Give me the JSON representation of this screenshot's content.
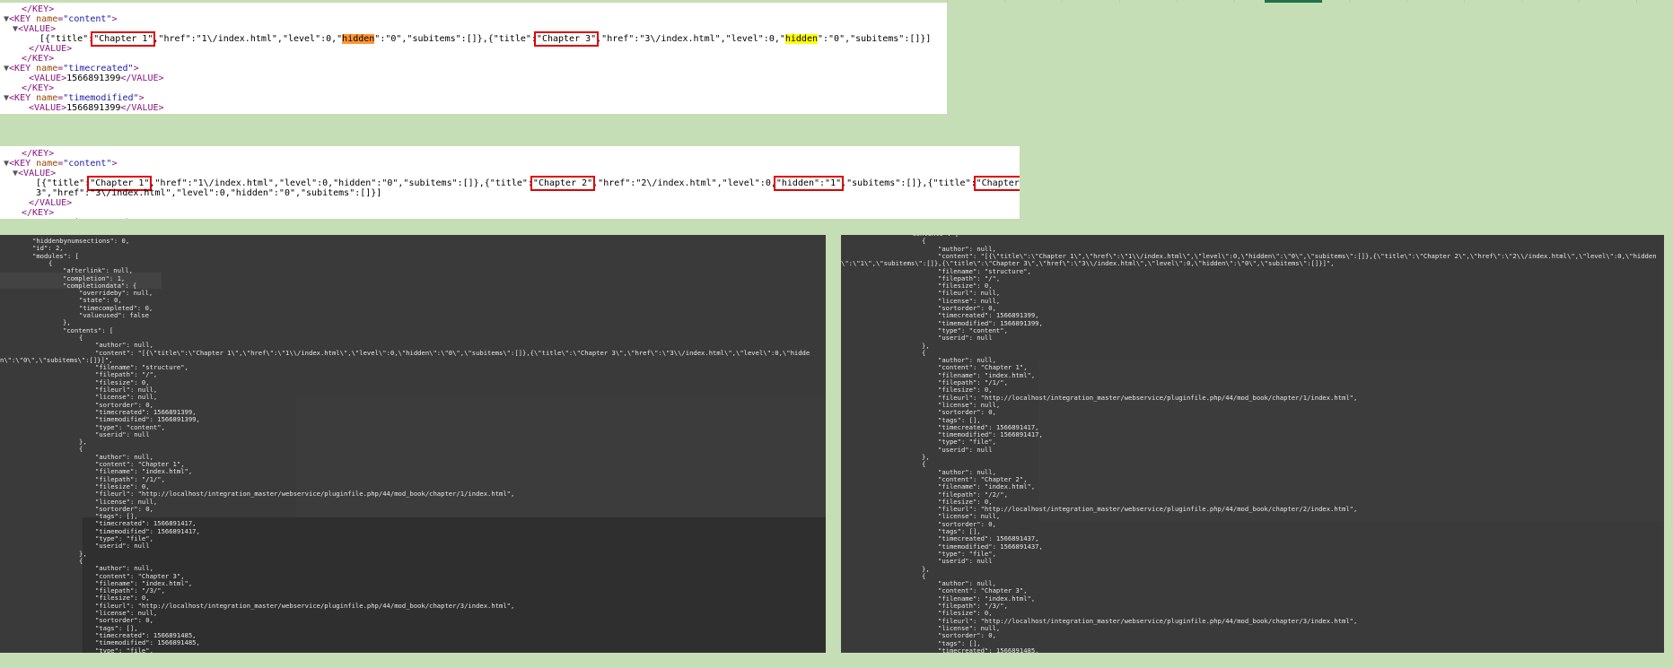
{
  "xml_view_1": {
    "lines": [
      {
        "indent": 24,
        "kind": "close",
        "text": "</KEY>"
      },
      {
        "indent": 14,
        "kind": "open",
        "tri": "▼",
        "tag": "KEY",
        "attr": "name",
        "val": "\"content\""
      },
      {
        "indent": 24,
        "kind": "open",
        "tri": "▼",
        "tag": "VALUE"
      },
      {
        "indent": 44,
        "kind": "data1"
      },
      {
        "indent": 32,
        "kind": "close",
        "text": "</VALUE>"
      },
      {
        "indent": 24,
        "kind": "close",
        "text": "</KEY>"
      },
      {
        "indent": 14,
        "kind": "open",
        "tri": "▼",
        "tag": "KEY",
        "attr": "name",
        "val": "\"timecreated\""
      },
      {
        "indent": 32,
        "kind": "valtext",
        "text": "1566891399"
      },
      {
        "indent": 24,
        "kind": "close",
        "text": "</KEY>"
      },
      {
        "indent": 14,
        "kind": "open",
        "tri": "▼",
        "tag": "KEY",
        "attr": "name",
        "val": "\"timemodified\""
      },
      {
        "indent": 32,
        "kind": "valtext",
        "text": "1566891399"
      }
    ],
    "data_line": {
      "p1": "[{\"title\":",
      "c1": "\"Chapter 1\"",
      "p2": ",\"href\":\"1\\/index.html\",\"level\":0,\"",
      "h1": "hidden",
      "p3": "\":\"0\",\"subitems\":[]},{\"title\":",
      "c2": "\"Chapter 3\"",
      "p4": ",\"href\":\"3\\/index.html\",\"level\":0,\"",
      "h2": "hidden",
      "p5": "\":\"0\",\"subitems\":[]}]"
    }
  },
  "xml_view_2": {
    "lines": [
      {
        "indent": 24,
        "kind": "close",
        "text": "</KEY>"
      },
      {
        "indent": 14,
        "kind": "open",
        "tri": "▼",
        "tag": "KEY",
        "attr": "name",
        "val": "\"content\""
      },
      {
        "indent": 24,
        "kind": "open",
        "tri": "▼",
        "tag": "VALUE"
      },
      {
        "indent": 40,
        "kind": "data2a"
      },
      {
        "indent": 40,
        "kind": "data2b"
      },
      {
        "indent": 32,
        "kind": "close",
        "text": "</VALUE>"
      },
      {
        "indent": 24,
        "kind": "close",
        "text": "</KEY>"
      },
      {
        "indent": 14,
        "kind": "open",
        "tri": "▼",
        "tag": "KEY",
        "attr": "name",
        "val": "\"timecreated\""
      }
    ],
    "data_line_a": {
      "p1": "[{\"title\":",
      "c1": "\"Chapter 1\"",
      "p2": ",\"href\":\"1\\/index.html\",\"level\":0,\"hidden\":\"0\",\"subitems\":[]},{\"title\":",
      "c2": "\"Chapter 2\"",
      "p3": ",\"href\":\"2\\/index.html\",\"level\":0,",
      "h1": "\"hidden\":\"1\"",
      "p4": ",\"subitems\":[]},{\"title\":",
      "c3": "\"Chapter"
    },
    "data_line_b": "3\",\"href\":\"3\\/index.html\",\"level\":0,\"hidden\":\"0\",\"subitems\":[]}]"
  },
  "json_view_left": [
    {
      "i": 36,
      "t": "\"hiddenbynumsections\": 0,"
    },
    {
      "i": 36,
      "t": "\"id\": 2,"
    },
    {
      "i": 36,
      "t": "\"modules\": ["
    },
    {
      "i": 54,
      "t": "{"
    },
    {
      "i": 70,
      "t": "\"afterlink\": null,"
    },
    {
      "i": 70,
      "t": "\"completion\": 1,"
    },
    {
      "i": 70,
      "t": "\"completiondata\": {"
    },
    {
      "i": 88,
      "t": "\"overrideby\": null,"
    },
    {
      "i": 88,
      "t": "\"state\": 0,"
    },
    {
      "i": 88,
      "t": "\"timecompleted\": 0,"
    },
    {
      "i": 88,
      "t": "\"valueused\": false"
    },
    {
      "i": 70,
      "t": "},"
    },
    {
      "i": 70,
      "t": "\"contents\": ["
    },
    {
      "i": 88,
      "t": "{"
    },
    {
      "i": 106,
      "t": "\"author\": null,"
    },
    {
      "i": 106,
      "t": "\"content\": \"[{\\\"title\\\":\\\"Chapter 1\\\",\\\"href\\\":\\\"1\\\\/index.html\\\",\\\"level\\\":0,\\\"hidden\\\":\\\"0\\\",\\\"subitems\\\":[]},{\\\"title\\\":\\\"Chapter 3\\\",\\\"href\\\":\\\"3\\\\/index.html\\\",\\\"level\\\":0,\\\"hidde"
    },
    {
      "i": 0,
      "t": "n\\\":\\\"0\\\",\\\"subitems\\\":[]}]\","
    },
    {
      "i": 106,
      "t": "\"filename\": \"structure\","
    },
    {
      "i": 106,
      "t": "\"filepath\": \"/\","
    },
    {
      "i": 106,
      "t": "\"filesize\": 0,"
    },
    {
      "i": 106,
      "t": "\"fileurl\": null,"
    },
    {
      "i": 106,
      "t": "\"license\": null,"
    },
    {
      "i": 106,
      "t": "\"sortorder\": 0,"
    },
    {
      "i": 106,
      "t": "\"timecreated\": 1566891399,"
    },
    {
      "i": 106,
      "t": "\"timemodified\": 1566891399,"
    },
    {
      "i": 106,
      "t": "\"type\": \"content\","
    },
    {
      "i": 106,
      "t": "\"userid\": null"
    },
    {
      "i": 88,
      "t": "},"
    },
    {
      "i": 88,
      "t": "{"
    },
    {
      "i": 106,
      "t": "\"author\": null,"
    },
    {
      "i": 106,
      "t": "\"content\": \"Chapter 1\","
    },
    {
      "i": 106,
      "t": "\"filename\": \"index.html\","
    },
    {
      "i": 106,
      "t": "\"filepath\": \"/1/\","
    },
    {
      "i": 106,
      "t": "\"filesize\": 0,"
    },
    {
      "i": 106,
      "t": "\"fileurl\": \"http://localhost/integration_master/webservice/pluginfile.php/44/mod_book/chapter/1/index.html\","
    },
    {
      "i": 106,
      "t": "\"license\": null,"
    },
    {
      "i": 106,
      "t": "\"sortorder\": 0,"
    },
    {
      "i": 106,
      "t": "\"tags\": [],"
    },
    {
      "i": 106,
      "t": "\"timecreated\": 1566891417,"
    },
    {
      "i": 106,
      "t": "\"timemodified\": 1566891417,"
    },
    {
      "i": 106,
      "t": "\"type\": \"file\","
    },
    {
      "i": 106,
      "t": "\"userid\": null"
    },
    {
      "i": 88,
      "t": "},"
    },
    {
      "i": 88,
      "t": "{"
    },
    {
      "i": 106,
      "t": "\"author\": null,"
    },
    {
      "i": 106,
      "t": "\"content\": \"Chapter 3\","
    },
    {
      "i": 106,
      "t": "\"filename\": \"index.html\","
    },
    {
      "i": 106,
      "t": "\"filepath\": \"/3/\","
    },
    {
      "i": 106,
      "t": "\"filesize\": 0,"
    },
    {
      "i": 106,
      "t": "\"fileurl\": \"http://localhost/integration_master/webservice/pluginfile.php/44/mod_book/chapter/3/index.html\","
    },
    {
      "i": 106,
      "t": "\"license\": null,"
    },
    {
      "i": 106,
      "t": "\"sortorder\": 0,"
    },
    {
      "i": 106,
      "t": "\"tags\": [],"
    },
    {
      "i": 106,
      "t": "\"timecreated\": 1566891485,"
    },
    {
      "i": 106,
      "t": "\"timemodified\": 1566891485,"
    },
    {
      "i": 106,
      "t": "\"type\": \"file\","
    }
  ],
  "json_view_right": [
    {
      "i": 75,
      "t": "\"contents\": ["
    },
    {
      "i": 90,
      "t": "{"
    },
    {
      "i": 108,
      "t": "\"author\": null,"
    },
    {
      "i": 108,
      "t": "\"content\": \"[{\\\"title\\\":\\\"Chapter 1\\\",\\\"href\\\":\\\"1\\\\/index.html\\\",\\\"level\\\":0,\\\"hidden\\\":\\\"0\\\",\\\"subitems\\\":[]},{\\\"title\\\":\\\"Chapter 2\\\",\\\"href\\\":\\\"2\\\\/index.html\\\",\\\"level\\\":0,\\\"hidden"
    },
    {
      "i": 0,
      "t": "\\\":\\\"1\\\",\\\"subitems\\\":[]},{\\\"title\\\":\\\"Chapter 3\\\",\\\"href\\\":\\\"3\\\\/index.html\\\",\\\"level\\\":0,\\\"hidden\\\":\\\"0\\\",\\\"subitems\\\":[]}]\","
    },
    {
      "i": 108,
      "t": "\"filename\": \"structure\","
    },
    {
      "i": 108,
      "t": "\"filepath\": \"/\","
    },
    {
      "i": 108,
      "t": "\"filesize\": 0,"
    },
    {
      "i": 108,
      "t": "\"fileurl\": null,"
    },
    {
      "i": 108,
      "t": "\"license\": null,"
    },
    {
      "i": 108,
      "t": "\"sortorder\": 0,"
    },
    {
      "i": 108,
      "t": "\"timecreated\": 1566891399,"
    },
    {
      "i": 108,
      "t": "\"timemodified\": 1566891399,"
    },
    {
      "i": 108,
      "t": "\"type\": \"content\","
    },
    {
      "i": 108,
      "t": "\"userid\": null"
    },
    {
      "i": 90,
      "t": "},"
    },
    {
      "i": 90,
      "t": "{"
    },
    {
      "i": 108,
      "t": "\"author\": null,"
    },
    {
      "i": 108,
      "t": "\"content\": \"Chapter 1\","
    },
    {
      "i": 108,
      "t": "\"filename\": \"index.html\","
    },
    {
      "i": 108,
      "t": "\"filepath\": \"/1/\","
    },
    {
      "i": 108,
      "t": "\"filesize\": 0,"
    },
    {
      "i": 108,
      "t": "\"fileurl\": \"http://localhost/integration_master/webservice/pluginfile.php/44/mod_book/chapter/1/index.html\","
    },
    {
      "i": 108,
      "t": "\"license\": null,"
    },
    {
      "i": 108,
      "t": "\"sortorder\": 0,"
    },
    {
      "i": 108,
      "t": "\"tags\": [],"
    },
    {
      "i": 108,
      "t": "\"timecreated\": 1566891417,"
    },
    {
      "i": 108,
      "t": "\"timemodified\": 1566891417,"
    },
    {
      "i": 108,
      "t": "\"type\": \"file\","
    },
    {
      "i": 108,
      "t": "\"userid\": null"
    },
    {
      "i": 90,
      "t": "},"
    },
    {
      "i": 90,
      "t": "{"
    },
    {
      "i": 108,
      "t": "\"author\": null,"
    },
    {
      "i": 108,
      "t": "\"content\": \"Chapter 2\","
    },
    {
      "i": 108,
      "t": "\"filename\": \"index.html\","
    },
    {
      "i": 108,
      "t": "\"filepath\": \"/2/\","
    },
    {
      "i": 108,
      "t": "\"filesize\": 0,"
    },
    {
      "i": 108,
      "t": "\"fileurl\": \"http://localhost/integration_master/webservice/pluginfile.php/44/mod_book/chapter/2/index.html\","
    },
    {
      "i": 108,
      "t": "\"license\": null,"
    },
    {
      "i": 108,
      "t": "\"sortorder\": 0,"
    },
    {
      "i": 108,
      "t": "\"tags\": [],"
    },
    {
      "i": 108,
      "t": "\"timecreated\": 1566891437,"
    },
    {
      "i": 108,
      "t": "\"timemodified\": 1566891437,"
    },
    {
      "i": 108,
      "t": "\"type\": \"file\","
    },
    {
      "i": 108,
      "t": "\"userid\": null"
    },
    {
      "i": 90,
      "t": "},"
    },
    {
      "i": 90,
      "t": "{"
    },
    {
      "i": 108,
      "t": "\"author\": null,"
    },
    {
      "i": 108,
      "t": "\"content\": \"Chapter 3\","
    },
    {
      "i": 108,
      "t": "\"filename\": \"index.html\","
    },
    {
      "i": 108,
      "t": "\"filepath\": \"/3/\","
    },
    {
      "i": 108,
      "t": "\"filesize\": 0,"
    },
    {
      "i": 108,
      "t": "\"fileurl\": \"http://localhost/integration_master/webservice/pluginfile.php/44/mod_book/chapter/3/index.html\","
    },
    {
      "i": 108,
      "t": "\"license\": null,"
    },
    {
      "i": 108,
      "t": "\"sortorder\": 0,"
    },
    {
      "i": 108,
      "t": "\"tags\": [],"
    },
    {
      "i": 108,
      "t": "\"timecreated\": 1566891485,"
    }
  ],
  "colors": {
    "background": "#c6deb5",
    "tag": "#881280",
    "attr_name": "#994500",
    "attr_value": "#1a1aa6",
    "highlight_box": "#e00000",
    "find_current": "#ff9632",
    "find_match": "#ffff00",
    "dark_panel": "#3a3a3a"
  }
}
